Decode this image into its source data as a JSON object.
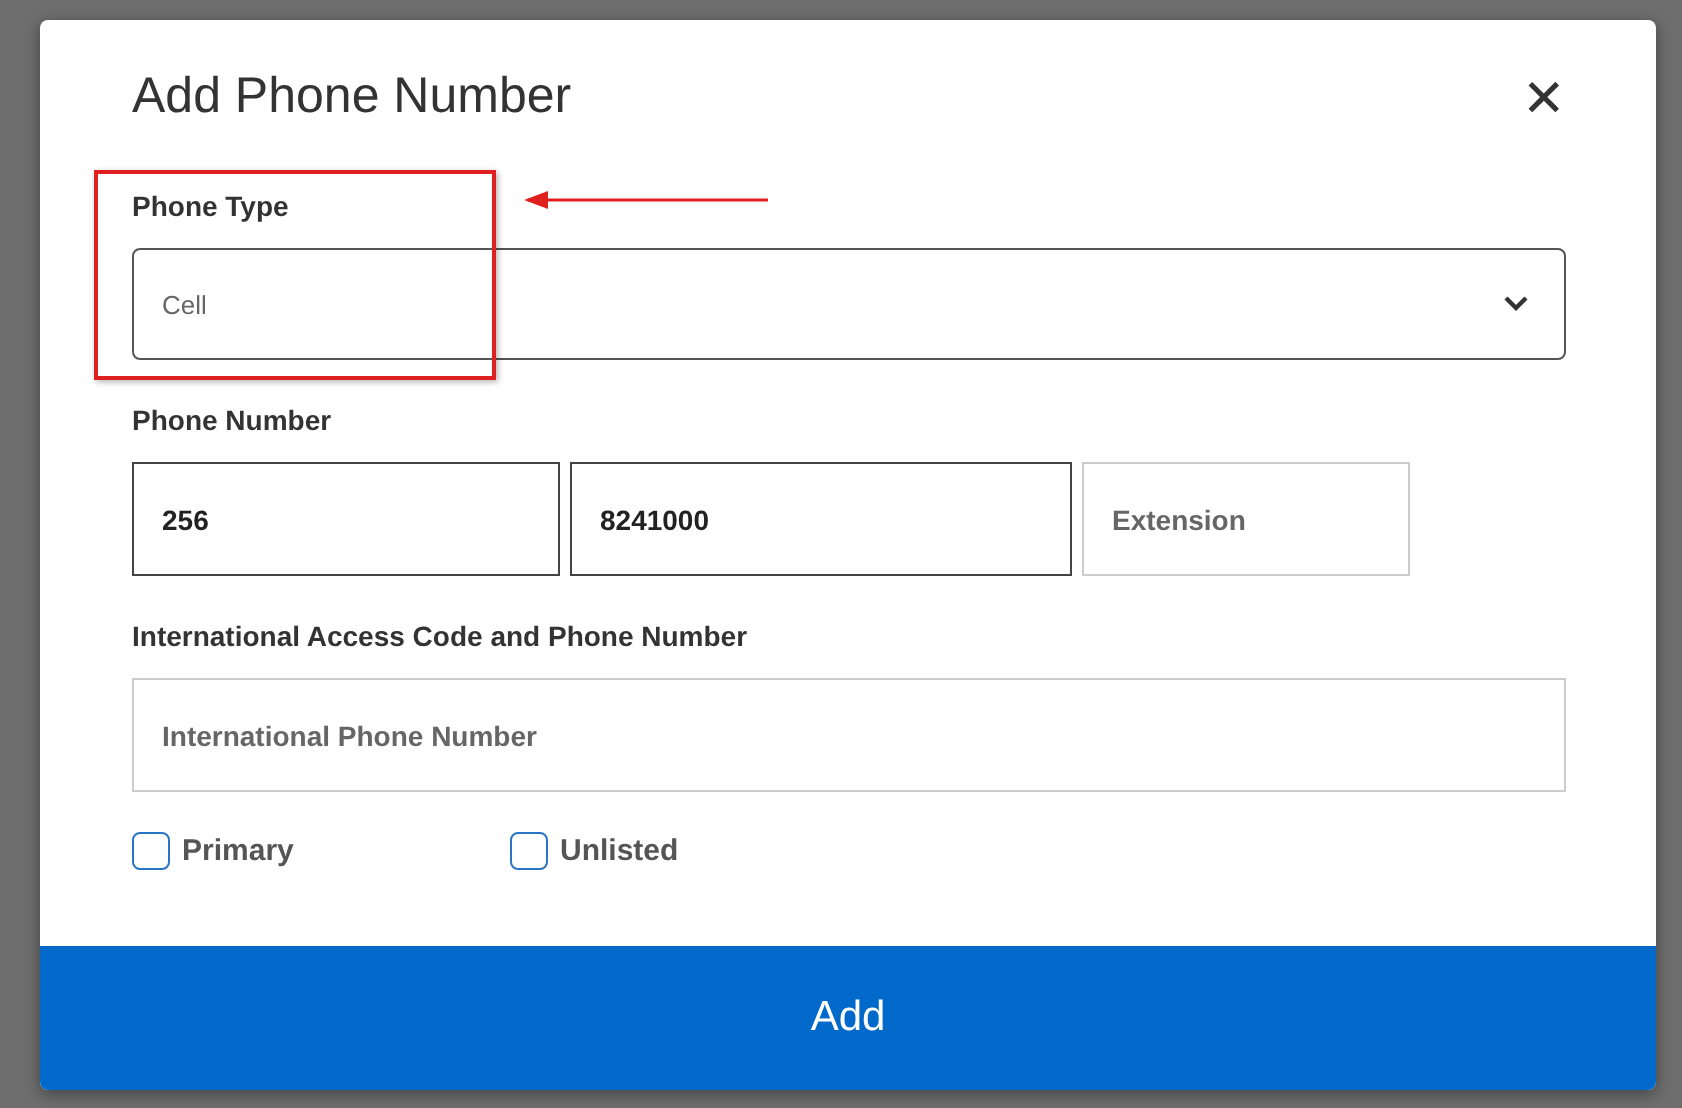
{
  "dialog": {
    "title": "Add Phone Number",
    "close": "✕"
  },
  "phone_type": {
    "label": "Phone Type",
    "value": "Cell"
  },
  "phone_number": {
    "label": "Phone Number",
    "area_code": "256",
    "number": "8241000",
    "extension_placeholder": "Extension"
  },
  "international": {
    "label": "International Access Code and Phone Number",
    "placeholder": "International Phone Number"
  },
  "checkboxes": [
    {
      "label": "Primary",
      "checked": false
    },
    {
      "label": "Unlisted",
      "checked": false
    }
  ],
  "buttons": [
    "Add"
  ]
}
